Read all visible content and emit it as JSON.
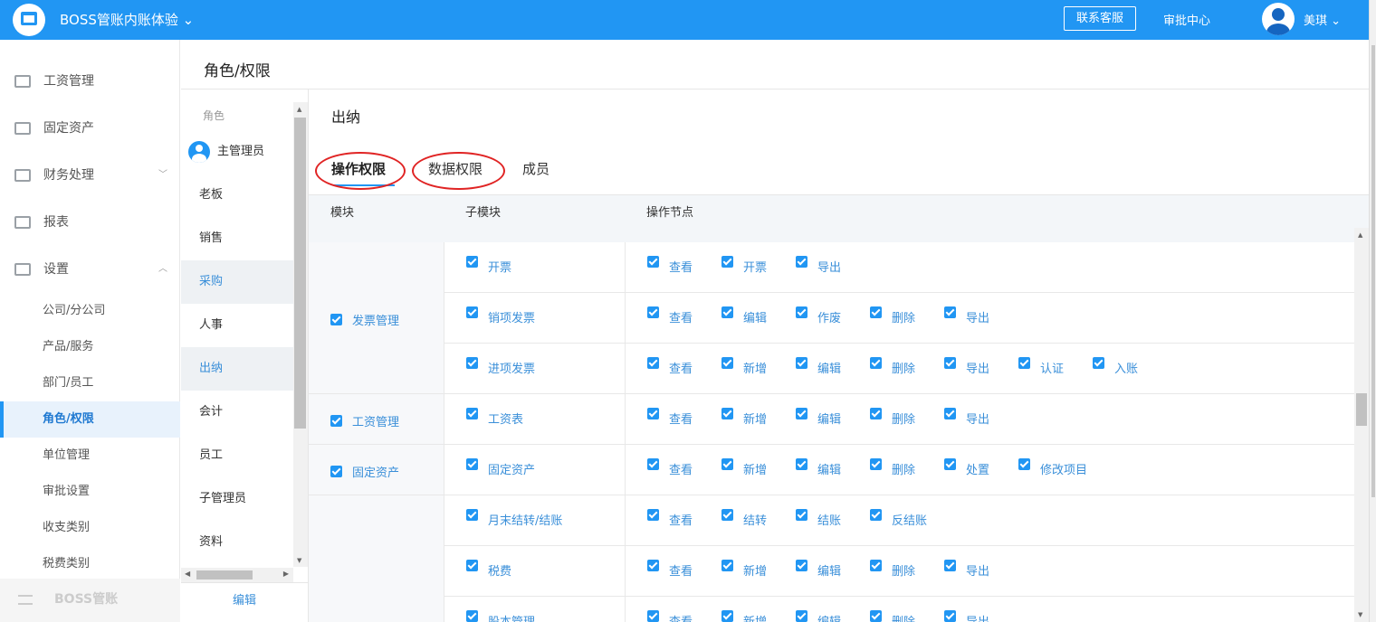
{
  "header": {
    "app_name": "BOSS管账内账体验",
    "service_label": "联系客服",
    "approval_label": "审批中心",
    "user_name": "美琪"
  },
  "sidebar": {
    "items": [
      {
        "label": "工资管理",
        "icon": "payroll-icon"
      },
      {
        "label": "固定资产",
        "icon": "asset-icon"
      },
      {
        "label": "财务处理",
        "icon": "finance-icon"
      },
      {
        "label": "报表",
        "icon": "report-icon"
      },
      {
        "label": "设置",
        "icon": "settings-icon"
      }
    ],
    "settings_sub": [
      "公司/分公司",
      "产品/服务",
      "部门/员工",
      "角色/权限",
      "单位管理",
      "审批设置",
      "收支类别",
      "税费类别"
    ],
    "active_sub": "角色/权限",
    "footer_label": "BOSS管账"
  },
  "page": {
    "title": "角色/权限"
  },
  "roles": {
    "header": "角色",
    "items": [
      "主管理员",
      "老板",
      "销售",
      "采购",
      "人事",
      "出纳",
      "会计",
      "员工",
      "子管理员",
      "资料"
    ],
    "edit_label": "编辑"
  },
  "detail": {
    "role_title": "出纳",
    "tabs": [
      "操作权限",
      "数据权限",
      "成员"
    ],
    "active_tab": "操作权限",
    "annotation_color": "#e02424"
  },
  "table": {
    "columns": [
      "模块",
      "子模块",
      "操作节点"
    ],
    "modules": [
      {
        "name": "发票管理",
        "rows": [
          {
            "sub": "开票",
            "actions": [
              "查看",
              "开票",
              "导出"
            ]
          },
          {
            "sub": "销项发票",
            "actions": [
              "查看",
              "编辑",
              "作废",
              "删除",
              "导出"
            ]
          },
          {
            "sub": "进项发票",
            "actions": [
              "查看",
              "新增",
              "编辑",
              "删除",
              "导出",
              "认证",
              "入账"
            ]
          }
        ]
      },
      {
        "name": "工资管理",
        "rows": [
          {
            "sub": "工资表",
            "actions": [
              "查看",
              "新增",
              "编辑",
              "删除",
              "导出"
            ]
          }
        ]
      },
      {
        "name": "固定资产",
        "rows": [
          {
            "sub": "固定资产",
            "actions": [
              "查看",
              "新增",
              "编辑",
              "删除",
              "处置",
              "修改项目"
            ]
          }
        ]
      },
      {
        "name": "",
        "rows": [
          {
            "sub": "月末结转/结账",
            "actions": [
              "查看",
              "结转",
              "结账",
              "反结账"
            ]
          },
          {
            "sub": "税费",
            "actions": [
              "查看",
              "新增",
              "编辑",
              "删除",
              "导出"
            ]
          },
          {
            "sub": "股本管理",
            "actions": [
              "查看",
              "新增",
              "编辑",
              "删除",
              "导出"
            ]
          }
        ]
      }
    ]
  },
  "colors": {
    "accent": "#2196f3",
    "link": "#3a8fd9"
  }
}
